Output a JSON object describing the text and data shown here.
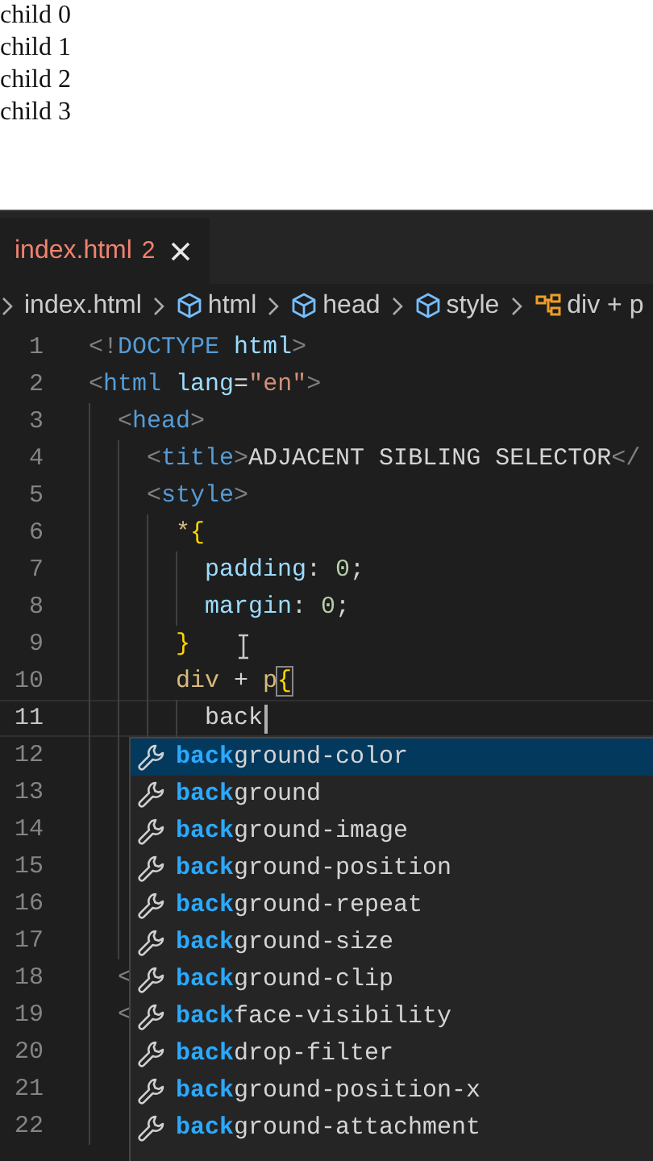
{
  "preview": {
    "lines": [
      "child 0",
      "child 1",
      "child 2",
      "child 3"
    ]
  },
  "tabs": [
    {
      "label": "index.html",
      "problems": "2",
      "has_errors": true,
      "selected": true
    }
  ],
  "breadcrumb": [
    {
      "kind": "file",
      "label": "index.html"
    },
    {
      "kind": "element",
      "label": "html"
    },
    {
      "kind": "element",
      "label": "head"
    },
    {
      "kind": "element",
      "label": "style"
    },
    {
      "kind": "selector",
      "label": "div + p"
    }
  ],
  "editor": {
    "lines": [
      {
        "number": "1",
        "current": false,
        "tokens": [
          {
            "kind": "punct",
            "text": "<!"
          },
          {
            "kind": "tag",
            "text": "DOCTYPE"
          },
          {
            "kind": "attr",
            "text": " html"
          },
          {
            "kind": "punct",
            "text": ">"
          }
        ]
      },
      {
        "number": "2",
        "current": false,
        "tokens": [
          {
            "kind": "punct",
            "text": "<"
          },
          {
            "kind": "tag",
            "text": "html"
          },
          {
            "kind": "attr",
            "text": " lang"
          },
          {
            "kind": "text",
            "text": "="
          },
          {
            "kind": "string",
            "text": "\"en\""
          },
          {
            "kind": "punct",
            "text": ">"
          }
        ],
        "children": [
          {
            "number": "3",
            "current": false,
            "tokens": [
              {
                "kind": "punct",
                "text": "<"
              },
              {
                "kind": "tag",
                "text": "head"
              },
              {
                "kind": "punct",
                "text": ">"
              }
            ],
            "children": [
              {
                "number": "4",
                "current": false,
                "tokens": [
                  {
                    "kind": "punct",
                    "text": "<"
                  },
                  {
                    "kind": "tag",
                    "text": "title"
                  },
                  {
                    "kind": "punct",
                    "text": ">"
                  },
                  {
                    "kind": "text",
                    "text": "ADJACENT SIBLING SELECTOR"
                  },
                  {
                    "kind": "punct",
                    "text": "</"
                  }
                ]
              },
              {
                "number": "5",
                "current": false,
                "tokens": [
                  {
                    "kind": "punct",
                    "text": "<"
                  },
                  {
                    "kind": "tag",
                    "text": "style"
                  },
                  {
                    "kind": "punct",
                    "text": ">"
                  }
                ],
                "children": [
                  {
                    "number": "6",
                    "current": false,
                    "tokens": [
                      {
                        "kind": "selector",
                        "text": "*"
                      },
                      {
                        "kind": "brace",
                        "text": "{",
                        "matched": false
                      }
                    ],
                    "children": [
                      {
                        "number": "7",
                        "current": false,
                        "tokens": [
                          {
                            "kind": "property",
                            "text": "padding"
                          },
                          {
                            "kind": "text",
                            "text": ": "
                          },
                          {
                            "kind": "number",
                            "text": "0"
                          },
                          {
                            "kind": "text",
                            "text": ";"
                          }
                        ]
                      },
                      {
                        "number": "8",
                        "current": false,
                        "tokens": [
                          {
                            "kind": "property",
                            "text": "margin"
                          },
                          {
                            "kind": "text",
                            "text": ": "
                          },
                          {
                            "kind": "number",
                            "text": "0"
                          },
                          {
                            "kind": "text",
                            "text": ";"
                          }
                        ]
                      }
                    ]
                  },
                  {
                    "number": "9",
                    "current": false,
                    "tokens": [
                      {
                        "kind": "brace",
                        "text": "}",
                        "matched": false
                      }
                    ]
                  },
                  {
                    "number": "10",
                    "current": false,
                    "tokens": [
                      {
                        "kind": "selector",
                        "text": "div"
                      },
                      {
                        "kind": "text",
                        "text": " + "
                      },
                      {
                        "kind": "selector",
                        "text": "p"
                      },
                      {
                        "kind": "brace",
                        "text": "{",
                        "matched": true
                      }
                    ],
                    "children": [
                      {
                        "number": "11",
                        "current": true,
                        "tokens": [
                          {
                            "kind": "text",
                            "text": "back"
                          }
                        ]
                      }
                    ]
                  }
                ]
              },
              {
                "number": "12",
                "current": false
              },
              {
                "number": "13",
                "current": false
              },
              {
                "number": "14",
                "current": false
              },
              {
                "number": "15",
                "current": false
              },
              {
                "number": "16",
                "current": false
              },
              {
                "number": "17",
                "current": false
              }
            ]
          },
          {
            "number": "18",
            "current": false,
            "tokens": [
              {
                "kind": "punct",
                "text": "<"
              }
            ]
          },
          {
            "number": "19",
            "current": false,
            "tokens": [
              {
                "kind": "punct",
                "text": "<"
              }
            ]
          },
          {
            "number": "20",
            "current": false
          },
          {
            "number": "21",
            "current": false
          },
          {
            "number": "22",
            "current": false
          }
        ]
      }
    ]
  },
  "suggestions": [
    {
      "match": "back",
      "rest": "ground-color",
      "selected": true
    },
    {
      "match": "back",
      "rest": "ground",
      "selected": false
    },
    {
      "match": "back",
      "rest": "ground-image",
      "selected": false
    },
    {
      "match": "back",
      "rest": "ground-position",
      "selected": false
    },
    {
      "match": "back",
      "rest": "ground-repeat",
      "selected": false
    },
    {
      "match": "back",
      "rest": "ground-size",
      "selected": false
    },
    {
      "match": "back",
      "rest": "ground-clip",
      "selected": false
    },
    {
      "match": "back",
      "rest": "face-visibility",
      "selected": false
    },
    {
      "match": "back",
      "rest": "drop-filter",
      "selected": false
    },
    {
      "match": "back",
      "rest": "ground-position-x",
      "selected": false
    },
    {
      "match": "back",
      "rest": "ground-attachment",
      "selected": false
    }
  ]
}
